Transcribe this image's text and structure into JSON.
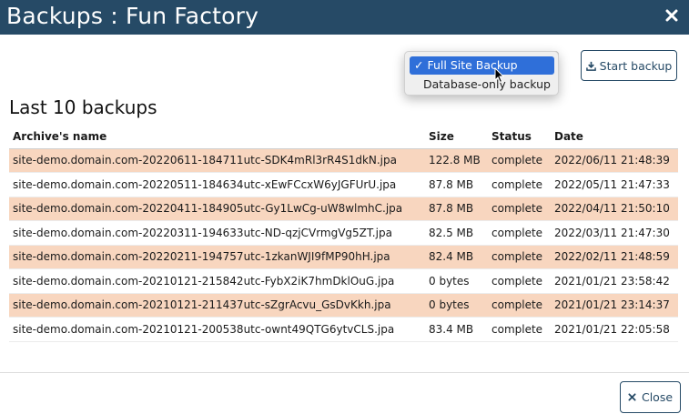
{
  "window": {
    "title": "Backups : Fun Factory"
  },
  "toolbar": {
    "backup_type_options": [
      "Full Site Backup",
      "Database-only backup"
    ],
    "selected_option": "Full Site Backup",
    "check_mark": "✓",
    "start_button_label": "Start backup"
  },
  "section": {
    "title": "Last 10 backups"
  },
  "table": {
    "headers": [
      "Archive's name",
      "Size",
      "Status",
      "Date"
    ],
    "rows": [
      [
        "site-demo.domain.com-20220611-184711utc-SDK4mRl3rR4S1dkN.jpa",
        "122.8 MB",
        "complete",
        "2022/06/11 21:48:39"
      ],
      [
        "site-demo.domain.com-20220511-184634utc-xEwFCcxW6yJGFUrU.jpa",
        "87.8 MB",
        "complete",
        "2022/05/11 21:47:33"
      ],
      [
        "site-demo.domain.com-20220411-184905utc-Gy1LwCg-uW8wlmhC.jpa",
        "87.8 MB",
        "complete",
        "2022/04/11 21:50:10"
      ],
      [
        "site-demo.domain.com-20220311-194633utc-ND-qzjCVrmgVg5ZT.jpa",
        "82.5 MB",
        "complete",
        "2022/03/11 21:47:30"
      ],
      [
        "site-demo.domain.com-20220211-194757utc-1zkanWJI9fMP90hH.jpa",
        "82.4 MB",
        "complete",
        "2022/02/11 21:48:59"
      ],
      [
        "site-demo.domain.com-20210121-215842utc-FybX2iK7hmDklOuG.jpa",
        "0 bytes",
        "complete",
        "2021/01/21 23:58:42"
      ],
      [
        "site-demo.domain.com-20210121-211437utc-sZgrAcvu_GsDvKkh.jpa",
        "0 bytes",
        "complete",
        "2021/01/21 23:14:37"
      ],
      [
        "site-demo.domain.com-20210121-200538utc-ownt49QTG6ytvCLS.jpa",
        "83.4 MB",
        "complete",
        "2021/01/21 22:05:58"
      ]
    ]
  },
  "footer": {
    "close_label": "Close"
  },
  "colors": {
    "header_bg": "#264a66",
    "row_highlight": "#f8d6bf",
    "selected_option": "#2f6fd9"
  }
}
